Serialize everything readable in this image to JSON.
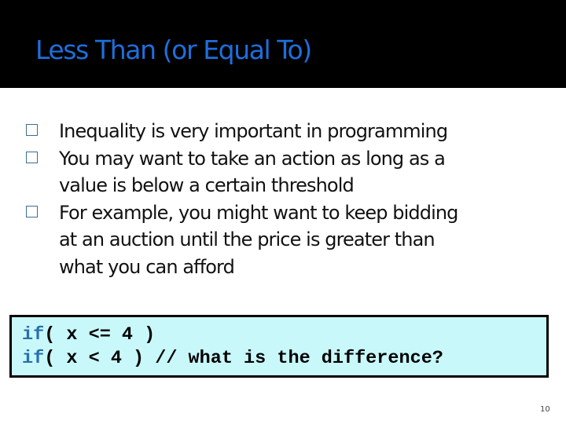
{
  "slide": {
    "title": "Less Than (or Equal To)",
    "bullets": [
      {
        "lines": [
          "Inequality is very important in programming"
        ]
      },
      {
        "lines": [
          "You may want to take an action as long as a",
          "value is below a certain threshold"
        ]
      },
      {
        "lines": [
          "For example, you might want to keep bidding",
          "at an auction until the price is greater than",
          "what you can afford"
        ]
      }
    ],
    "bullet_icon": "square-outline-bullet-icon",
    "code": [
      {
        "keyword": "if",
        "rest": "( x <= 4 )"
      },
      {
        "keyword": "if",
        "rest": "( x < 4 ) // what is the difference?"
      }
    ],
    "page_number": "10"
  },
  "colors": {
    "title": "#1e6fdc",
    "header_bg": "#000000",
    "code_bg": "#c8f8fa",
    "keyword": "#2a6fa8",
    "bullet_box": "#3f6d8f"
  }
}
